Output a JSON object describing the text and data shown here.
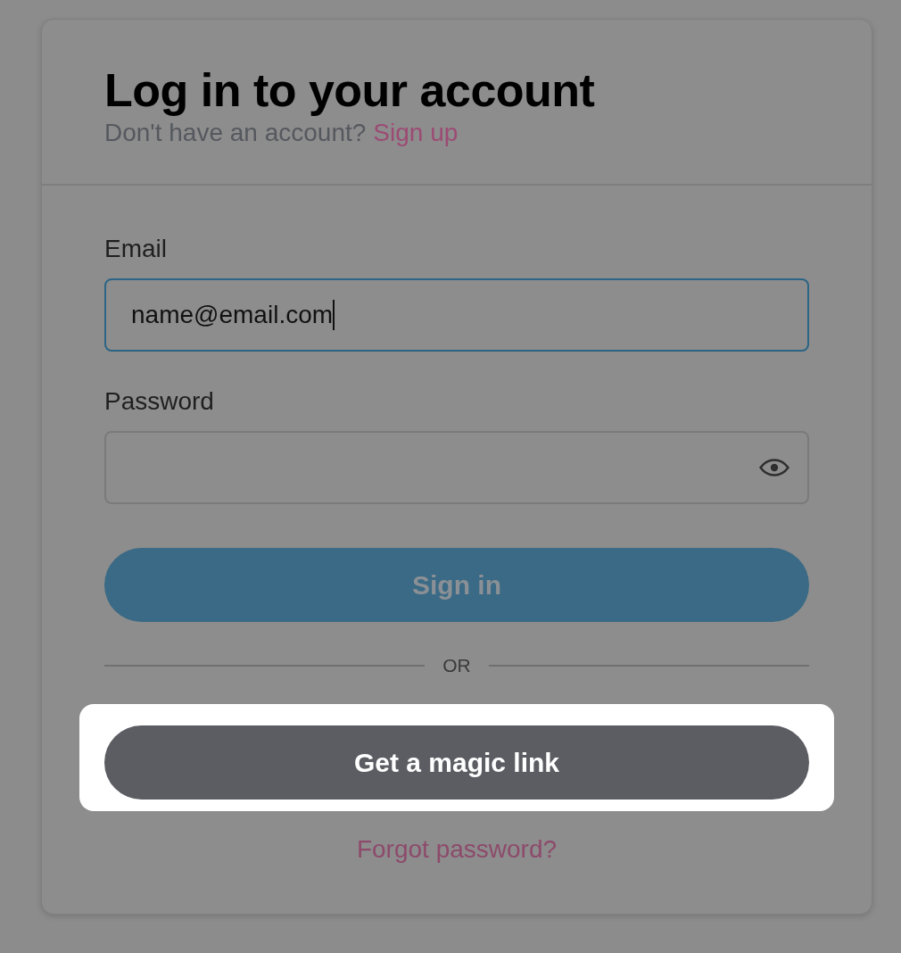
{
  "header": {
    "title": "Log in to your account",
    "prompt": "Don't have an account?",
    "signup_link": "Sign up"
  },
  "fields": [
    {
      "label": "Email",
      "kind": "email",
      "value": "name@email.com",
      "focused": true
    },
    {
      "label": "Password",
      "kind": "password",
      "focused": false
    }
  ],
  "sign_in_button": {
    "label": "Sign in",
    "disabled": true
  },
  "divider": {
    "text": "OR"
  },
  "magic_link_button": {
    "label": "Get a magic link",
    "highlighted": true
  },
  "forgot_link": "Forgot password?"
}
